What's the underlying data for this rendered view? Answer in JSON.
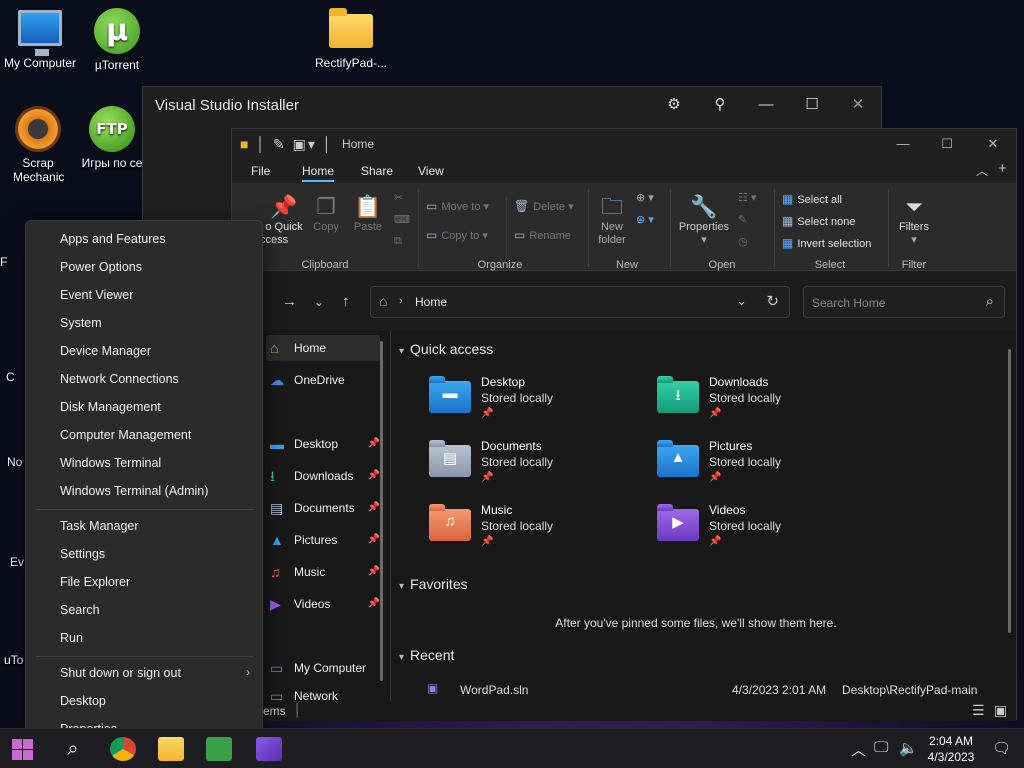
{
  "desktop": {
    "icons": [
      {
        "label": "My Computer"
      },
      {
        "label": "µTorrent"
      },
      {
        "label": "RectifyPad-..."
      },
      {
        "label": "Scrap Mechanic"
      },
      {
        "label": "Игры по се"
      },
      {
        "label": "No"
      },
      {
        "label": "Ev"
      },
      {
        "label": "uTo"
      },
      {
        "label": "F"
      },
      {
        "label": "C"
      }
    ]
  },
  "vs_installer": {
    "title": "Visual Studio Installer"
  },
  "explorer": {
    "title": "Home",
    "menu": [
      "File",
      "Home",
      "Share",
      "View"
    ],
    "active_menu": "Home",
    "ribbon": {
      "pin_quick_access": "o Quick",
      "pin_quick_access_2": "ccess",
      "copy": "Copy",
      "paste": "Paste",
      "clipboard": "Clipboard",
      "move_to": "Move to",
      "copy_to": "Copy to",
      "delete": "Delete",
      "rename": "Rename",
      "organize": "Organize",
      "new_folder_1": "New",
      "new_folder_2": "folder",
      "new": "New",
      "properties": "Properties",
      "open": "Open",
      "select_all": "Select all",
      "select_none": "Select none",
      "invert_selection": "Invert selection",
      "select": "Select",
      "filters": "Filters",
      "filter": "Filter"
    },
    "address": {
      "location": "Home"
    },
    "search": {
      "placeholder": "Search Home"
    },
    "nav_pane": [
      {
        "label": "Home"
      },
      {
        "label": "OneDrive"
      },
      {
        "label": "Desktop"
      },
      {
        "label": "Downloads"
      },
      {
        "label": "Documents"
      },
      {
        "label": "Pictures"
      },
      {
        "label": "Music"
      },
      {
        "label": "Videos"
      },
      {
        "label": "My Computer"
      },
      {
        "label": "Network"
      }
    ],
    "quick_access_title": "Quick access",
    "quick_access": [
      {
        "name": "Desktop",
        "sub": "Stored locally"
      },
      {
        "name": "Downloads",
        "sub": "Stored locally"
      },
      {
        "name": "Documents",
        "sub": "Stored locally"
      },
      {
        "name": "Pictures",
        "sub": "Stored locally"
      },
      {
        "name": "Music",
        "sub": "Stored locally"
      },
      {
        "name": "Videos",
        "sub": "Stored locally"
      }
    ],
    "favorites_title": "Favorites",
    "favorites_empty": "After you've pinned some files, we'll show them here.",
    "recent_title": "Recent",
    "recent": [
      {
        "name": "WordPad.sln",
        "date": "4/3/2023 2:01 AM",
        "location": "Desktop\\RectifyPad-main"
      }
    ],
    "status": "ems"
  },
  "winx_menu": {
    "group1": [
      "Apps and Features",
      "Power Options",
      "Event Viewer",
      "System",
      "Device Manager",
      "Network Connections",
      "Disk Management",
      "Computer Management",
      "Windows Terminal",
      "Windows Terminal (Admin)"
    ],
    "group2": [
      "Task Manager",
      "Settings",
      "File Explorer",
      "Search",
      "Run"
    ],
    "group3": [
      "Shut down or sign out",
      "Desktop",
      "Properties"
    ]
  },
  "taskbar": {
    "time": "2:04 AM",
    "date": "4/3/2023"
  },
  "colors": {
    "accent": "#4cc2ff",
    "folder": "#f0b430"
  }
}
